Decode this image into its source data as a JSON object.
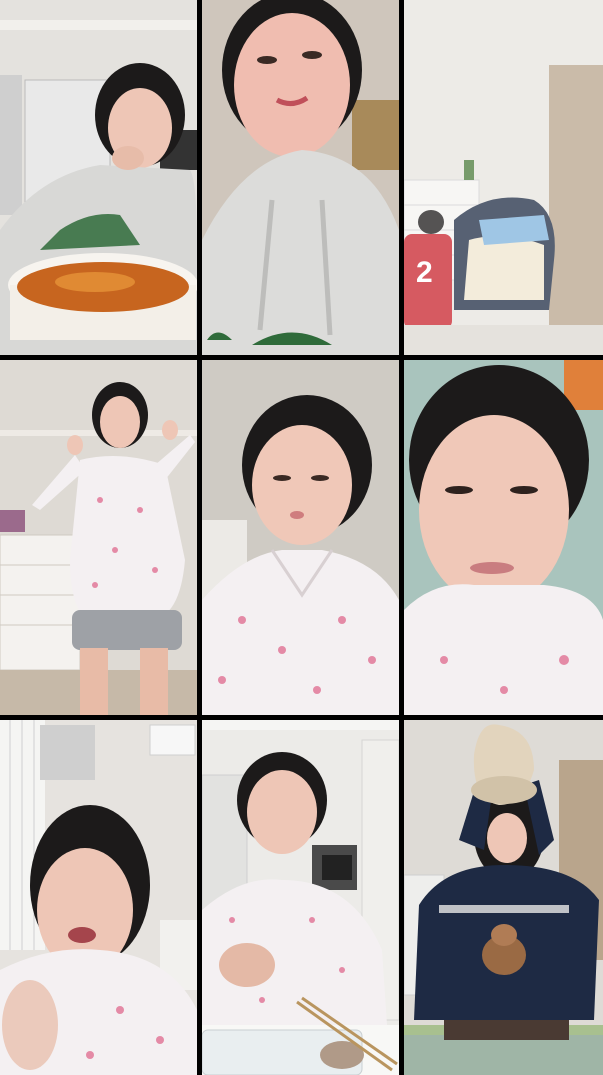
{
  "grid": {
    "rows": 3,
    "columns": 3,
    "tiles": [
      {
        "scene": "eating-bowl",
        "jersey_text": ""
      },
      {
        "scene": "closeup-hoodie",
        "jersey_text": ""
      },
      {
        "scene": "room-back-view",
        "jersey_text": "2"
      },
      {
        "scene": "dancing-pajamas",
        "jersey_text": ""
      },
      {
        "scene": "closeup-pajamas",
        "jersey_text": ""
      },
      {
        "scene": "lying-pillow",
        "jersey_text": ""
      },
      {
        "scene": "talking-gesture",
        "jersey_text": ""
      },
      {
        "scene": "eating-kitchen",
        "jersey_text": ""
      },
      {
        "scene": "hat-over-head",
        "jersey_text": ""
      }
    ]
  },
  "colors": {
    "gutter": "#000000",
    "wall": "#d9d6d2",
    "hoodie": "#d8d8d6",
    "pajama": "#f4f0f2",
    "pajama_print": "#e48aa6",
    "hair": "#1c1a1a",
    "skin": "#eec6b6",
    "jersey": "#c8232c",
    "sweater": "#1e2a44"
  }
}
